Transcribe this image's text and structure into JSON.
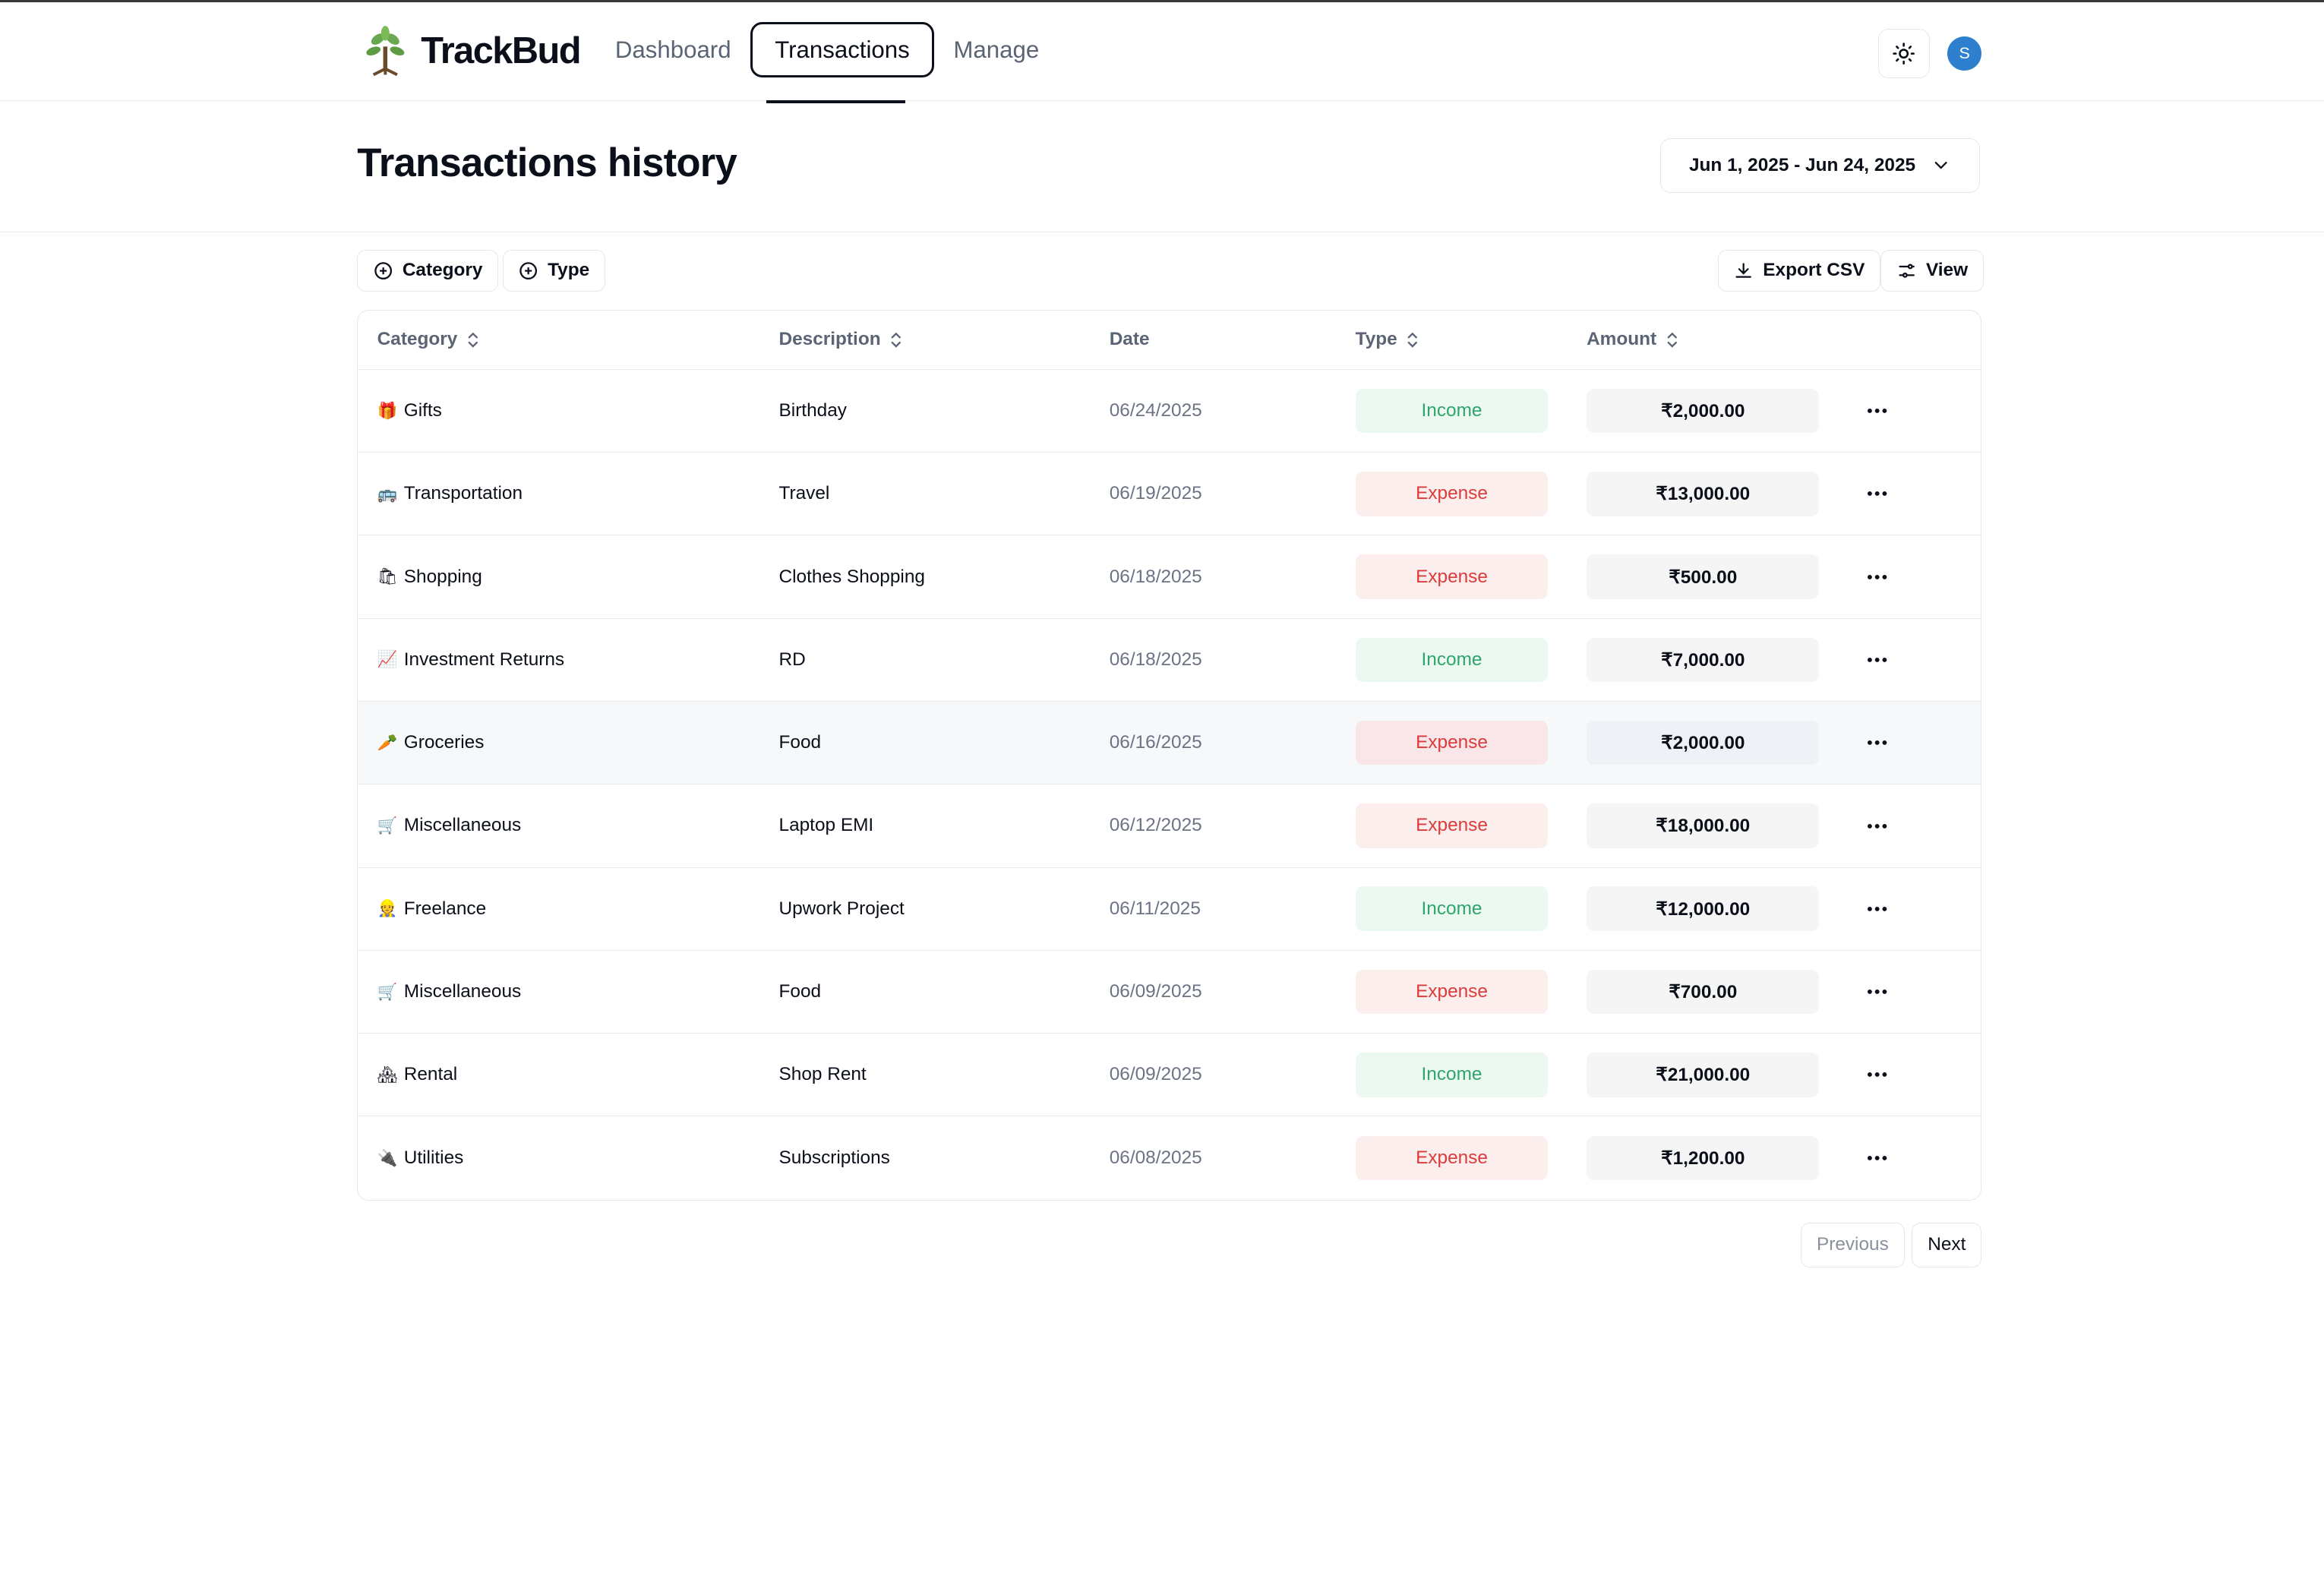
{
  "app": {
    "name": "TrackBud"
  },
  "nav": {
    "items": [
      {
        "label": "Dashboard"
      },
      {
        "label": "Transactions"
      },
      {
        "label": "Manage"
      }
    ]
  },
  "user": {
    "initial": "S"
  },
  "page": {
    "title": "Transactions history",
    "date_range": "Jun 1, 2025 - Jun 24, 2025"
  },
  "filters": {
    "category_label": "Category",
    "type_label": "Type",
    "export_label": "Export CSV",
    "view_label": "View"
  },
  "table": {
    "headers": {
      "category": "Category",
      "description": "Description",
      "date": "Date",
      "type": "Type",
      "amount": "Amount"
    },
    "rows": [
      {
        "emoji": "🎁",
        "category": "Gifts",
        "description": "Birthday",
        "date": "06/24/2025",
        "type": "Income",
        "amount": "₹2,000.00"
      },
      {
        "emoji": "🚌",
        "category": "Transportation",
        "description": "Travel",
        "date": "06/19/2025",
        "type": "Expense",
        "amount": "₹13,000.00"
      },
      {
        "emoji": "🛍",
        "category": "Shopping",
        "description": "Clothes Shopping",
        "date": "06/18/2025",
        "type": "Expense",
        "amount": "₹500.00"
      },
      {
        "emoji": "📈",
        "category": "Investment Returns",
        "description": "RD",
        "date": "06/18/2025",
        "type": "Income",
        "amount": "₹7,000.00"
      },
      {
        "emoji": "🥕",
        "category": "Groceries",
        "description": "Food",
        "date": "06/16/2025",
        "type": "Expense",
        "amount": "₹2,000.00"
      },
      {
        "emoji": "🛒",
        "category": "Miscellaneous",
        "description": "Laptop EMI",
        "date": "06/12/2025",
        "type": "Expense",
        "amount": "₹18,000.00"
      },
      {
        "emoji": "👷",
        "category": "Freelance",
        "description": "Upwork Project",
        "date": "06/11/2025",
        "type": "Income",
        "amount": "₹12,000.00"
      },
      {
        "emoji": "🛒",
        "category": "Miscellaneous",
        "description": "Food",
        "date": "06/09/2025",
        "type": "Expense",
        "amount": "₹700.00"
      },
      {
        "emoji": "🏘",
        "category": "Rental",
        "description": "Shop Rent",
        "date": "06/09/2025",
        "type": "Income",
        "amount": "₹21,000.00"
      },
      {
        "emoji": "🔌",
        "category": "Utilities",
        "description": "Subscriptions",
        "date": "06/08/2025",
        "type": "Expense",
        "amount": "₹1,200.00"
      }
    ]
  },
  "pagination": {
    "previous_label": "Previous",
    "next_label": "Next"
  },
  "colors": {
    "income_text": "#2ea56b",
    "income_bg": "#ecf9f1",
    "expense_text": "#dc3b3b",
    "expense_bg": "#fdeeee",
    "avatar_bg": "#2f7fcf"
  }
}
